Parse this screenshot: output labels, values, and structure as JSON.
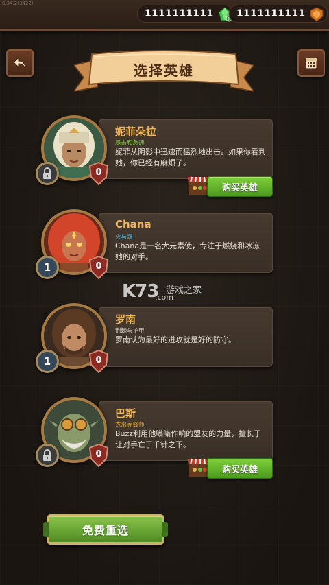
{
  "version": "0.34.2(3422)",
  "currencies": [
    {
      "value": "1111111111",
      "icon": "green-gem-icon"
    },
    {
      "value": "1111111111",
      "icon": "shield-token-icon"
    }
  ],
  "header": {
    "title": "选择英雄"
  },
  "heroes": [
    {
      "name": "妮菲朵拉",
      "subtitle": "暴击和急速",
      "subtitle_color": "#7ecb3a",
      "description": "妮菲从阴影中迅速而猛烈地出击。如果你看到她，你已经有麻烦了。",
      "locked": true,
      "level": "",
      "rank": "0",
      "buy_label": "购买英雄"
    },
    {
      "name": "Chana",
      "subtitle": "火与霜",
      "subtitle_color": "#4fb3e8",
      "description": "Chana是一名大元素使，专注于燃烧和冰冻她的对手。",
      "locked": false,
      "level": "1",
      "rank": "0",
      "buy_label": ""
    },
    {
      "name": "罗南",
      "subtitle": "荆棘与护甲",
      "subtitle_color": "#d9cfc4",
      "description": "罗南认为最好的进攻就是好的防守。",
      "locked": false,
      "level": "1",
      "rank": "0",
      "buy_label": ""
    },
    {
      "name": "巴斯",
      "subtitle": "杰出养蜂师",
      "subtitle_color": "#e0a133",
      "description": "Buzz利用他嗡嗡作响的盟友的力量，擅长于让对手亡于千针之下。",
      "locked": true,
      "level": "",
      "rank": "0",
      "buy_label": "购买英雄"
    }
  ],
  "watermark": {
    "big": "K73",
    "small": "游戏之家",
    "com": ".com"
  },
  "reroll_label": "免费重选"
}
